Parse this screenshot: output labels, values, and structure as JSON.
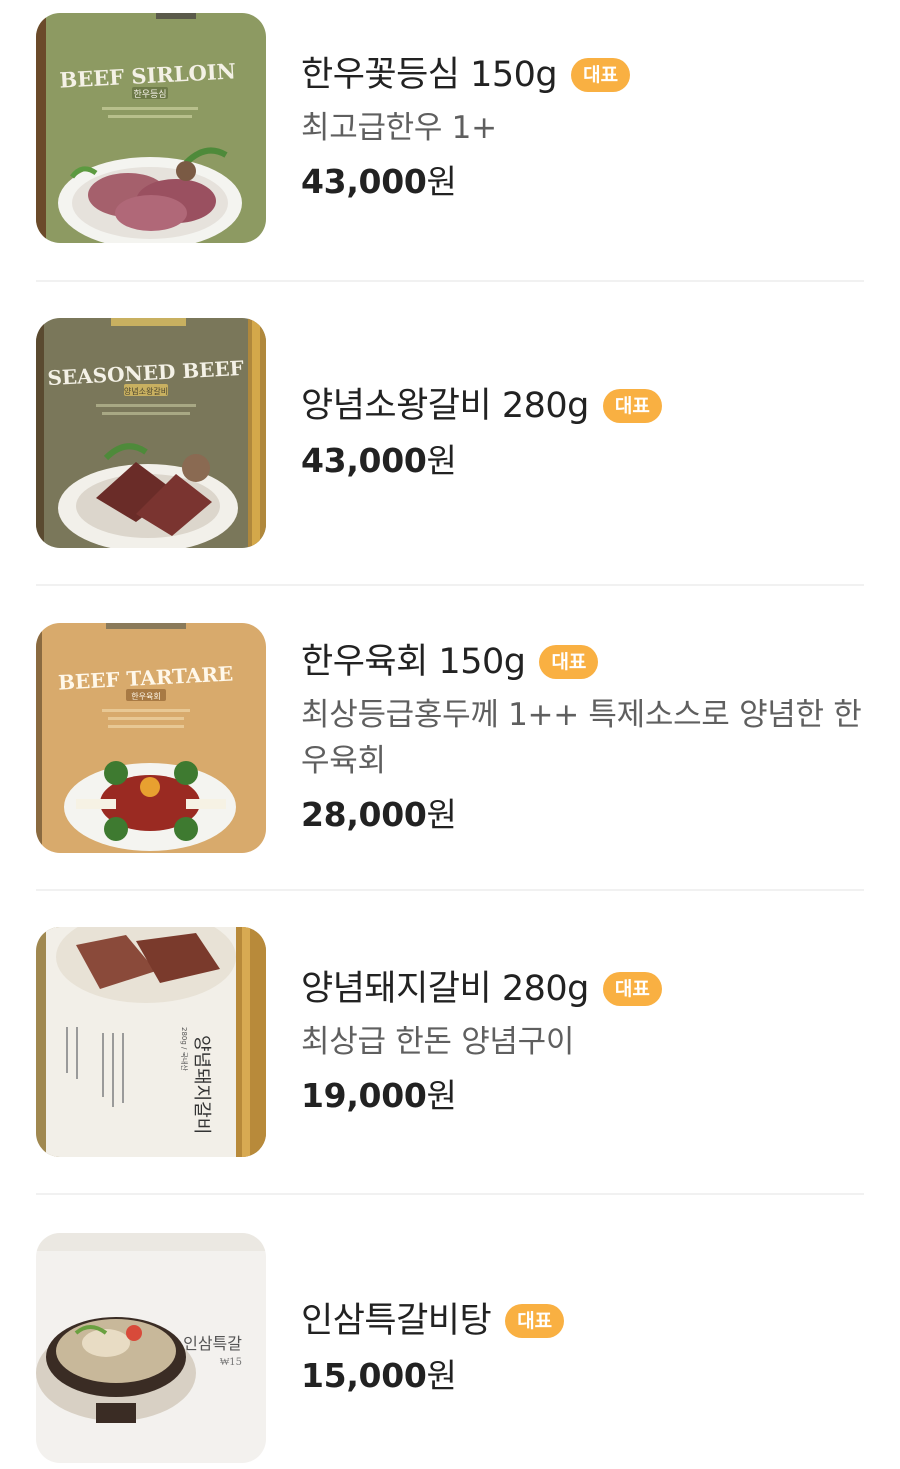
{
  "menu": {
    "items": [
      {
        "name": "한우꽃등심 150g",
        "badge": "대표",
        "description": "최고급한우 1+",
        "price_number": "43,000",
        "price_unit": "원",
        "image_text": {
          "title": "BEEF SIRLOIN",
          "label": "한우등심"
        },
        "image_icon": "beef-sirloin-photo-icon"
      },
      {
        "name": "양념소왕갈비 280g",
        "badge": "대표",
        "description": "",
        "price_number": "43,000",
        "price_unit": "원",
        "image_text": {
          "title": "SEASONED BEEF",
          "label": "양념소왕갈비"
        },
        "image_icon": "seasoned-beef-photo-icon"
      },
      {
        "name": "한우육회 150g",
        "badge": "대표",
        "description": "최상등급홍두께 1++ 특제소스로 양념한 한우육회",
        "price_number": "28,000",
        "price_unit": "원",
        "image_text": {
          "title": "BEEF TARTARE",
          "label": "한우육회"
        },
        "image_icon": "beef-tartare-photo-icon"
      },
      {
        "name": "양념돼지갈비 280g",
        "badge": "대표",
        "description": "최상급 한돈 양념구이",
        "price_number": "19,000",
        "price_unit": "원",
        "image_text": {
          "title": "양념돼지갈비",
          "label": "280g / 국내산"
        },
        "image_icon": "pork-ribs-photo-icon"
      },
      {
        "name": "인삼특갈비탕",
        "badge": "대표",
        "description": "",
        "price_number": "15,000",
        "price_unit": "원",
        "image_text": {
          "title": "인삼특갈",
          "label": "₩15"
        },
        "image_icon": "galbitang-photo-icon"
      }
    ]
  },
  "colors": {
    "badge": "#f9b042",
    "divider": "#f1f1f1",
    "title": "#222222",
    "description": "#5f5f5f"
  }
}
